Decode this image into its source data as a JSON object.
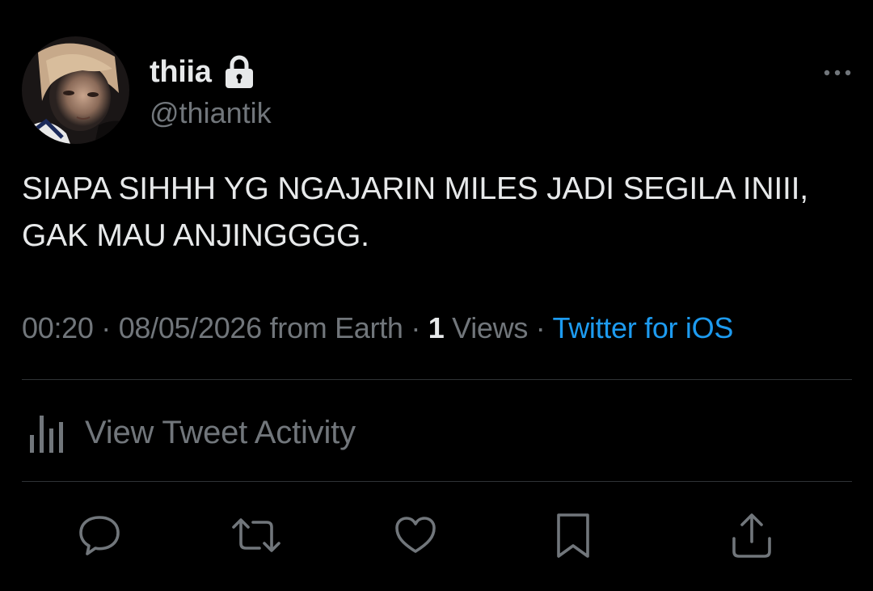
{
  "user": {
    "display_name": "thiia",
    "handle": "@thiantik",
    "protected_icon": "lock-icon",
    "avatar_icon": "avatar"
  },
  "menu": {
    "icon": "more-icon"
  },
  "tweet": {
    "text": "SIAPA SIHHH YG NGAJARIN MILES JADI SEGILA INIII, GAK MAU ANJINGGGG."
  },
  "meta": {
    "time": "00:20",
    "sep1": " · ",
    "date": "08/05/2026",
    "location": " from Earth",
    "sep2": " · ",
    "views_count": "1",
    "views_label": " Views",
    "sep3": " · ",
    "source": "Twitter for iOS"
  },
  "activity": {
    "icon": "analytics-icon",
    "label": "View Tweet Activity"
  },
  "actions": [
    {
      "name": "reply-icon"
    },
    {
      "name": "retweet-icon"
    },
    {
      "name": "like-icon"
    },
    {
      "name": "bookmark-icon"
    },
    {
      "name": "share-icon"
    }
  ],
  "colors": {
    "background": "#000000",
    "text_primary": "#e7e9ea",
    "text_secondary": "#71767b",
    "link": "#1d9bf0",
    "divider": "#2f3336"
  }
}
